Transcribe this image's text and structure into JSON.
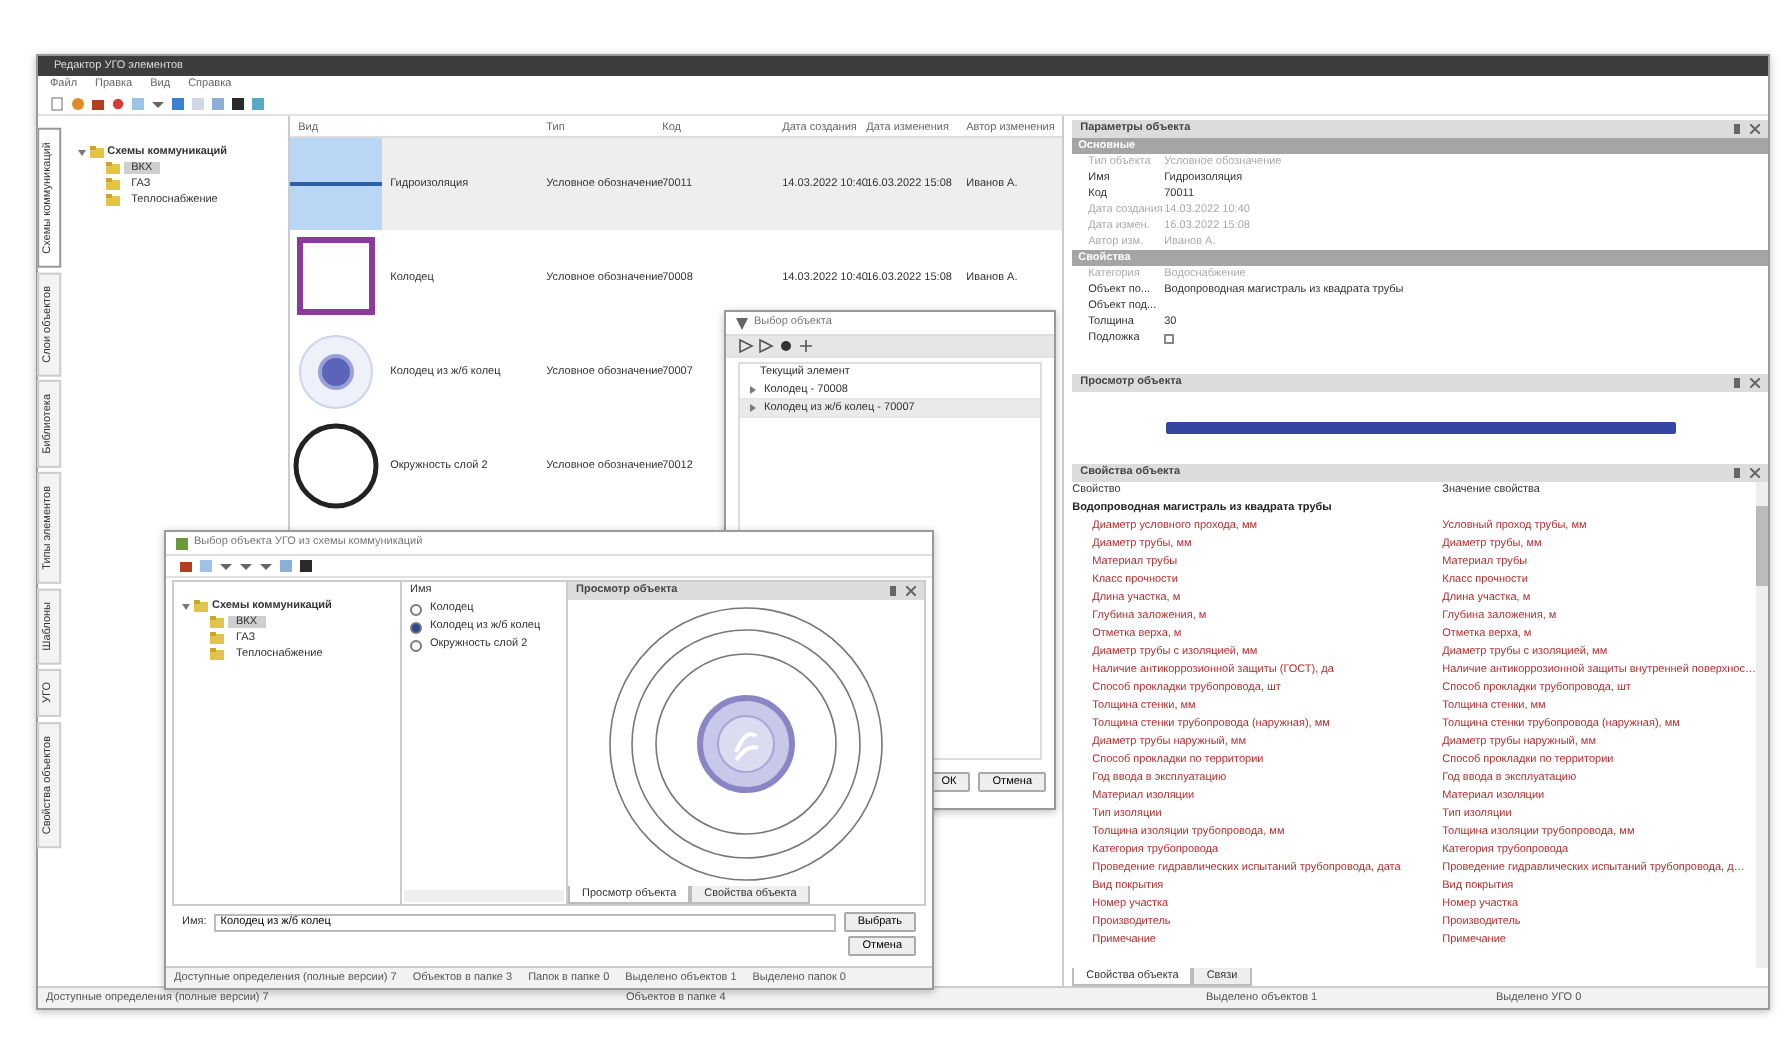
{
  "window": {
    "title": "Редактор УГО элементов"
  },
  "menu": [
    "Файл",
    "Правка",
    "Вид",
    "Справка"
  ],
  "side_tabs": [
    {
      "label": "Схемы коммуникаций",
      "selected": true
    },
    {
      "label": "Слои объектов",
      "selected": false
    },
    {
      "label": "Библиотека",
      "selected": false
    },
    {
      "label": "Типы элементов",
      "selected": false
    },
    {
      "label": "Шаблоны",
      "selected": false
    },
    {
      "label": "УГО",
      "selected": false
    },
    {
      "label": "Свойства объектов",
      "selected": false
    }
  ],
  "tree": {
    "label": "Схемы коммуникаций",
    "expanded": true,
    "children": [
      {
        "label": "ВКХ",
        "selected": true
      },
      {
        "label": "ГАЗ",
        "selected": false
      },
      {
        "label": "Теплоснабжение",
        "selected": false
      }
    ]
  },
  "objects": {
    "columns": [
      "Вид",
      "Тип",
      "Код",
      "Дата создания",
      "Дата изменения",
      "Автор изменения"
    ],
    "rows": [
      {
        "kind": "line",
        "cells": [
          "Гидроизоляция",
          "Условное обозначение",
          "70011",
          "14.03.2022 10:40",
          "16.03.2022 15:08",
          "Иванов А."
        ],
        "selected": true
      },
      {
        "kind": "square",
        "cells": [
          "Колодец",
          "Условное обозначение",
          "70008",
          "14.03.2022 10:40",
          "16.03.2022 15:08",
          "Иванов А."
        ],
        "selected": false
      },
      {
        "kind": "disk",
        "cells": [
          "Колодец из ж/б колец",
          "Условное обозначение",
          "70007"
        ],
        "selected": false
      },
      {
        "kind": "ring",
        "cells": [
          "Окружность слой 2",
          "Условное обозначение",
          "70012"
        ],
        "selected": false
      }
    ]
  },
  "parameters": {
    "title": "Параметры объекта",
    "groups": [
      {
        "title": "Основные",
        "rows": [
          {
            "label": "Тип объекта",
            "value": "Условное обозначение",
            "disabled": true
          },
          {
            "label": "Имя",
            "value": "Гидроизоляция",
            "disabled": false
          },
          {
            "label": "Код",
            "value": "70011",
            "disabled": false
          },
          {
            "label": "Дата создания",
            "value": "14.03.2022 10:40",
            "disabled": true
          },
          {
            "label": "Дата измен.",
            "value": "16.03.2022 15:08",
            "disabled": true
          },
          {
            "label": "Автор изм.",
            "value": "Иванов А.",
            "disabled": true
          }
        ]
      },
      {
        "title": "Свойства",
        "rows": [
          {
            "label": "Категория",
            "value": "Водоснабжение",
            "disabled": true
          },
          {
            "label": "Объект по...",
            "value": "Водопроводная магистраль из квадрата трубы",
            "disabled": false
          },
          {
            "label": "Объект под...",
            "value": "",
            "disabled": false
          },
          {
            "label": "Толщина",
            "value": "30",
            "disabled": false
          },
          {
            "label": "Подложка",
            "checked": false,
            "disabled": false
          }
        ]
      }
    ]
  },
  "preview": {
    "title": "Просмотр объекта"
  },
  "properties": {
    "title": "Свойства объекта",
    "columns": [
      "Свойство",
      "Значение свойства"
    ],
    "group": "Водопроводная магистраль из квадрата трубы",
    "rows": [
      [
        "Диаметр условного прохода, мм",
        "Условный проход трубы, мм"
      ],
      [
        "Диаметр трубы, мм",
        "Диаметр трубы, мм"
      ],
      [
        "Материал трубы",
        "Материал трубы"
      ],
      [
        "Класс прочности",
        "Класс прочности"
      ],
      [
        "Длина участка, м",
        "Длина участка, м"
      ],
      [
        "Глубина заложения, м",
        "Глубина заложения, м"
      ],
      [
        "Отметка верха, м",
        "Отметка верха, м"
      ],
      [
        "Диаметр трубы с изоляцией, мм",
        "Диаметр трубы с изоляцией, мм"
      ],
      [
        "Наличие антикоррозионной защиты (ГОСТ), да",
        "Наличие антикоррозионной защиты внутренней поверхнос…"
      ],
      [
        "Способ прокладки трубопровода, шт",
        "Способ прокладки трубопровода, шт"
      ],
      [
        "Толщина стенки, мм",
        "Толщина стенки, мм"
      ],
      [
        "Толщина стенки трубопровода (наружная), мм",
        "Толщина стенки трубопровода (наружная), мм"
      ],
      [
        "Диаметр трубы наружный, мм",
        "Диаметр трубы наружный, мм"
      ],
      [
        "Способ прокладки по территории",
        "Способ прокладки по территории"
      ],
      [
        "Год ввода в эксплуатацию",
        "Год ввода в эксплуатацию"
      ],
      [
        "Материал изоляции",
        "Материал изоляции"
      ],
      [
        "Тип изоляции",
        "Тип изоляции"
      ],
      [
        "Толщина изоляции трубопровода, мм",
        "Толщина изоляции трубопровода, мм"
      ],
      [
        "Категория трубопровода",
        "Категория трубопровода"
      ],
      [
        "Проведение гидравлических испытаний трубопровода, дата",
        "Проведение гидравлических испытаний трубопровода, д…"
      ],
      [
        "Вид покрытия",
        "Вид покрытия"
      ],
      [
        "Номер участка",
        "Номер участка"
      ],
      [
        "Производитель",
        "Производитель"
      ],
      [
        "Примечание",
        "Примечание"
      ]
    ],
    "tabs": [
      {
        "label": "Свойства объекта",
        "selected": true
      },
      {
        "label": "Связи",
        "selected": false
      }
    ]
  },
  "status_bar": [
    "Доступные определения (полные версии) 7",
    "Объектов в папке 4",
    "Выделено объектов 1",
    "Выделено УГО 0"
  ],
  "select_dialog": {
    "title": "Выбор объекта",
    "header": "Текущий элемент",
    "items": [
      {
        "label": "Колодец - 70008",
        "selected": false
      },
      {
        "label": "Колодец из ж/б колец - 70007",
        "selected": true
      }
    ],
    "buttons": [
      "ОК",
      "Отмена"
    ]
  },
  "ugo_dialog": {
    "title": "Выбор объекта УГО из схемы коммуникаций",
    "tree": {
      "label": "Схемы коммуникаций",
      "expanded": true,
      "children": [
        {
          "label": "ВКХ",
          "selected": true
        },
        {
          "label": "ГАЗ",
          "selected": false
        },
        {
          "label": "Теплоснабжение",
          "selected": false
        }
      ]
    },
    "list_header": "Имя",
    "items": [
      {
        "label": "Колодец",
        "selected": false
      },
      {
        "label": "Колодец из ж/б колец",
        "selected": true
      },
      {
        "label": "Окружность слой 2",
        "selected": false
      }
    ],
    "preview_title": "Просмотр объекта",
    "tabs": [
      {
        "label": "Просмотр объекта",
        "selected": true
      },
      {
        "label": "Свойства объекта",
        "selected": false
      }
    ],
    "name_label": "Имя:",
    "name_value": "Колодец из ж/б колец",
    "buttons": [
      "Выбрать",
      "Отмена"
    ],
    "status_bar": [
      "Доступные определения (полные версии) 7",
      "Объектов в папке 3",
      "Папок в папке 0",
      "Выделено объектов 1",
      "Выделено папок 0"
    ]
  }
}
